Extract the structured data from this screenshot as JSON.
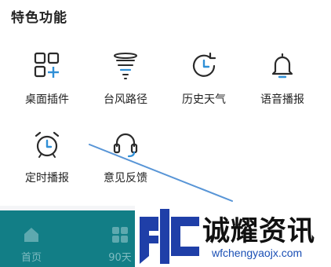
{
  "section": {
    "title": "特色功能"
  },
  "features": [
    {
      "label": "桌面插件",
      "icon": "widget-add-icon"
    },
    {
      "label": "台风路径",
      "icon": "typhoon-icon"
    },
    {
      "label": "历史天气",
      "icon": "history-clock-icon"
    },
    {
      "label": "语音播报",
      "icon": "bell-icon"
    },
    {
      "label": "定时播报",
      "icon": "alarm-clock-icon"
    },
    {
      "label": "意见反馈",
      "icon": "headset-icon"
    }
  ],
  "tabbar": {
    "items": [
      {
        "label": "首页",
        "icon": "home-icon"
      },
      {
        "label": "90天",
        "icon": "grid-icon"
      }
    ]
  },
  "watermark": {
    "title": "诚耀资讯",
    "url": "wfchengyaojx.com"
  },
  "colors": {
    "icon_stroke": "#2a2a2a",
    "icon_accent": "#2f8fd6",
    "tabbar_bg": "#127e86",
    "tab_text": "#7fbcc1",
    "logo_blue": "#1f3fa8"
  }
}
